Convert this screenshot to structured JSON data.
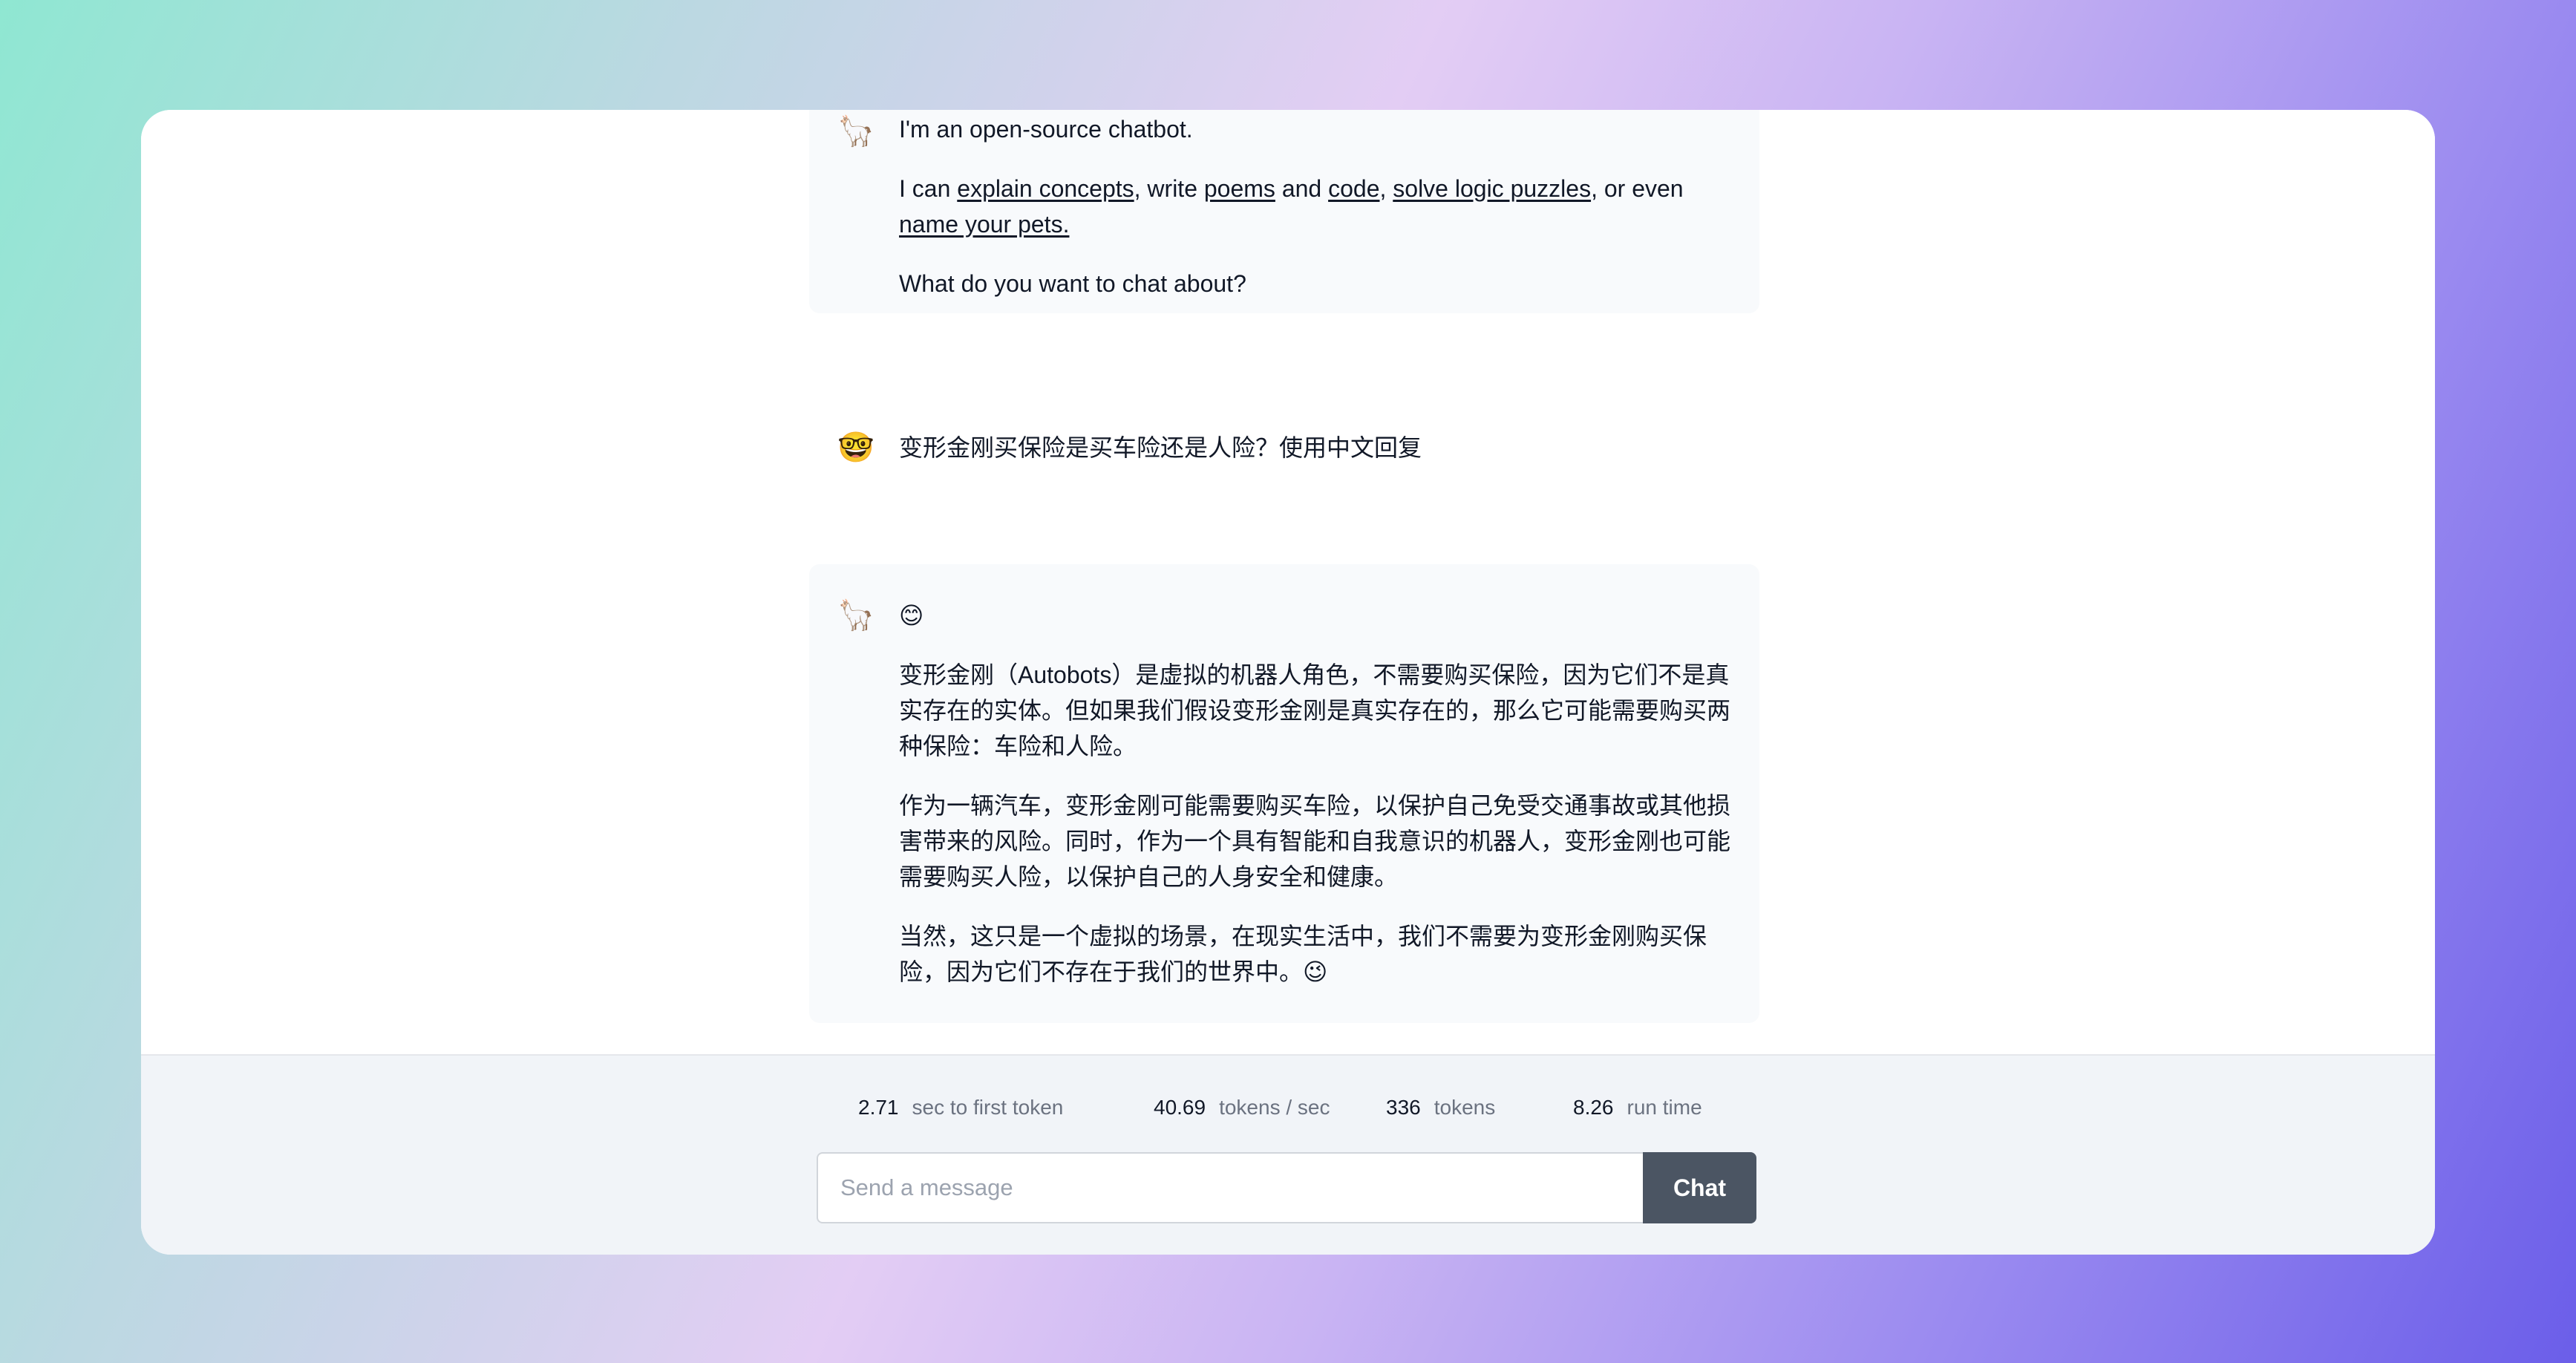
{
  "conversation": {
    "intro": {
      "avatar": "🦙",
      "line1": "I'm an open-source chatbot.",
      "line2_prefix": "I can ",
      "link_explain": "explain concepts",
      "sep1": ", write ",
      "link_poems": "poems",
      "sep2": " and ",
      "link_code": "code",
      "sep3": ", ",
      "link_puzzles": "solve logic puzzles",
      "sep4": ", or even ",
      "link_pets": "name your pets.",
      "line3": "What do you want to chat about?"
    },
    "user_message": {
      "avatar": "🤓",
      "text": "变形金刚买保险是买车险还是人险？使用中文回复"
    },
    "bot_reply": {
      "avatar": "🦙",
      "emoji": "😊",
      "paragraphs": [
        "变形金刚（Autobots）是虚拟的机器人角色，不需要购买保险，因为它们不是真实存在的实体。但如果我们假设变形金刚是真实存在的，那么它可能需要购买两种保险：车险和人险。",
        "作为一辆汽车，变形金刚可能需要购买车险，以保护自己免受交通事故或其他损害带来的风险。同时，作为一个具有智能和自我意识的机器人，变形金刚也可能需要购买人险，以保护自己的人身安全和健康。",
        "当然，这只是一个虚拟的场景，在现实生活中，我们不需要为变形金刚购买保险，因为它们不存在于我们的世界中。😉"
      ]
    }
  },
  "stats": [
    {
      "value": "2.71",
      "label": "sec to first token"
    },
    {
      "value": "40.69",
      "label": "tokens / sec"
    },
    {
      "value": "336",
      "label": "tokens"
    },
    {
      "value": "8.26",
      "label": "run time"
    }
  ],
  "composer": {
    "placeholder": "Send a message",
    "value": "",
    "button_label": "Chat"
  },
  "colors": {
    "bot_bubble": "#f8fafc",
    "footer_bg": "#f1f4f8",
    "button_bg": "#4b5563",
    "gradient_start": "#8fe7d2",
    "gradient_end": "#6b5ee9"
  }
}
